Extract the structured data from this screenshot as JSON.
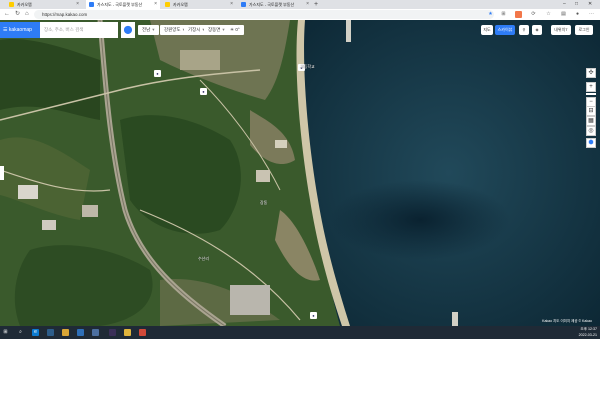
{
  "browser": {
    "tabs": [
      {
        "title": "카카오맵",
        "active": false
      },
      {
        "title": "가스지도 - 국토플랫 부동산",
        "active": true
      },
      {
        "title": "카카오맵",
        "active": false
      },
      {
        "title": "가스지도 - 국토플랫 부동산",
        "active": false
      }
    ],
    "new_tab_symbol": "+",
    "url": "https://map.kakao.com",
    "window_controls": [
      "–",
      "□",
      "✕"
    ]
  },
  "map": {
    "logo_text": "kakaomap",
    "search_placeholder": "장소, 주소, 버스 검색",
    "crumbs": [
      "전남",
      "강원양도",
      "기장시",
      "장동면"
    ],
    "weather": "0°",
    "right_buttons": [
      "지도",
      "스카이뷰",
      "",
      "",
      "내위치T",
      "로그인"
    ],
    "zoom_in": "+",
    "zoom_out": "−",
    "footer": "Kakao 지도 이미지 제공 © Kakao",
    "labels": [
      "고등학교",
      "수산리",
      "장동"
    ]
  },
  "taskbar": {
    "time": "오후 12:37",
    "date": "2022-03-21"
  },
  "colors": {
    "accent": "#2e7cf6",
    "taskbar": "#1f2a36",
    "sea": "#0f2d3d",
    "land": "#3d5b2c"
  }
}
